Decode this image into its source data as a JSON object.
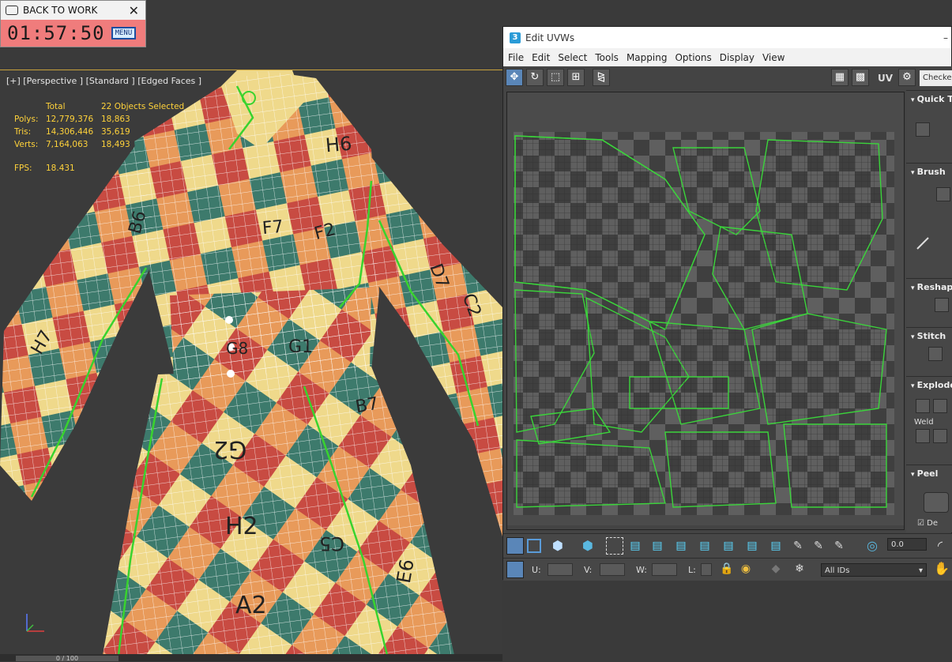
{
  "timer": {
    "title": "BACK TO WORK",
    "time": "01:57:50",
    "menu_label": "MENU",
    "close_label": "✕"
  },
  "viewport": {
    "label": "[+] [Perspective ] [Standard ] [Edged Faces ]",
    "stats": {
      "header_total": "Total",
      "header_selected": "22 Objects Selected",
      "rows": [
        {
          "label": "Polys:",
          "total": "12,779,376",
          "selected": "18,863"
        },
        {
          "label": "Tris:",
          "total": "14,306,446",
          "selected": "35,619"
        },
        {
          "label": "Verts:",
          "total": "7,164,063",
          "selected": "18,493"
        }
      ],
      "fps_label": "FPS:",
      "fps_value": "18.431"
    },
    "patch_labels": [
      "H6",
      "F7",
      "G8",
      "G1",
      "G2",
      "H2",
      "A2",
      "C5",
      "B7",
      "H7",
      "D7",
      "E6",
      "C2",
      "F2",
      "B6"
    ],
    "timeline": "0 / 100",
    "colors": {
      "checker_red": "#c84b42",
      "checker_yellow": "#efd98b",
      "checker_orange": "#e89a5a",
      "checker_teal": "#3d7a6c",
      "seam_green": "#39d32e",
      "stats_yellow": "#ffd23a"
    }
  },
  "uvw": {
    "title": "Edit UVWs",
    "app_icon": "3",
    "menu": [
      "File",
      "Edit",
      "Select",
      "Tools",
      "Mapping",
      "Options",
      "Display",
      "View"
    ],
    "toolbar_uv_label": "UV",
    "checker_label": "Checker",
    "sidebar": [
      "Quick T",
      "Brush",
      "Reshap",
      "Stitch",
      "Explode",
      "Peel"
    ],
    "weld_label": "Weld",
    "peel_option": "De",
    "bottom": {
      "spin_value": "0.0",
      "u_label": "U:",
      "v_label": "V:",
      "w_label": "W:",
      "l_label": "L:",
      "ids_select": "All IDs"
    }
  }
}
